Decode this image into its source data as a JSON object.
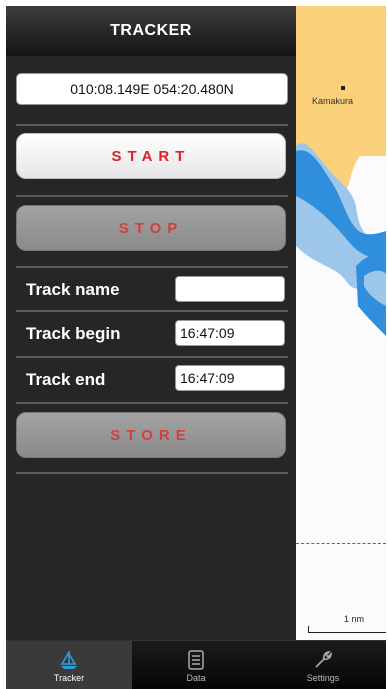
{
  "header": {
    "title": "TRACKER"
  },
  "position": {
    "coordinates": "010:08.149E  054:20.480N"
  },
  "buttons": {
    "start": "START",
    "stop": "STOP",
    "store": "STORE"
  },
  "form": {
    "track_name": {
      "label": "Track name",
      "value": ""
    },
    "track_begin": {
      "label": "Track begin",
      "value": "16:47:09"
    },
    "track_end": {
      "label": "Track end",
      "value": "16:47:09"
    }
  },
  "map": {
    "place_label": "Kamakura",
    "scale_label": "1 nm"
  },
  "tabs": [
    {
      "label": "Tracker",
      "icon": "sailboat-icon",
      "active": true
    },
    {
      "label": "Data",
      "icon": "document-icon",
      "active": false
    },
    {
      "label": "Settings",
      "icon": "wrench-icon",
      "active": false
    }
  ],
  "colors": {
    "button_text_start": "#e2202a",
    "button_text_inactive": "#d04040",
    "land": "#fbd07a",
    "water_shallow": "#9dc7ea",
    "water_deep": "#2f8fdc",
    "accent": "#2e9cdc"
  }
}
